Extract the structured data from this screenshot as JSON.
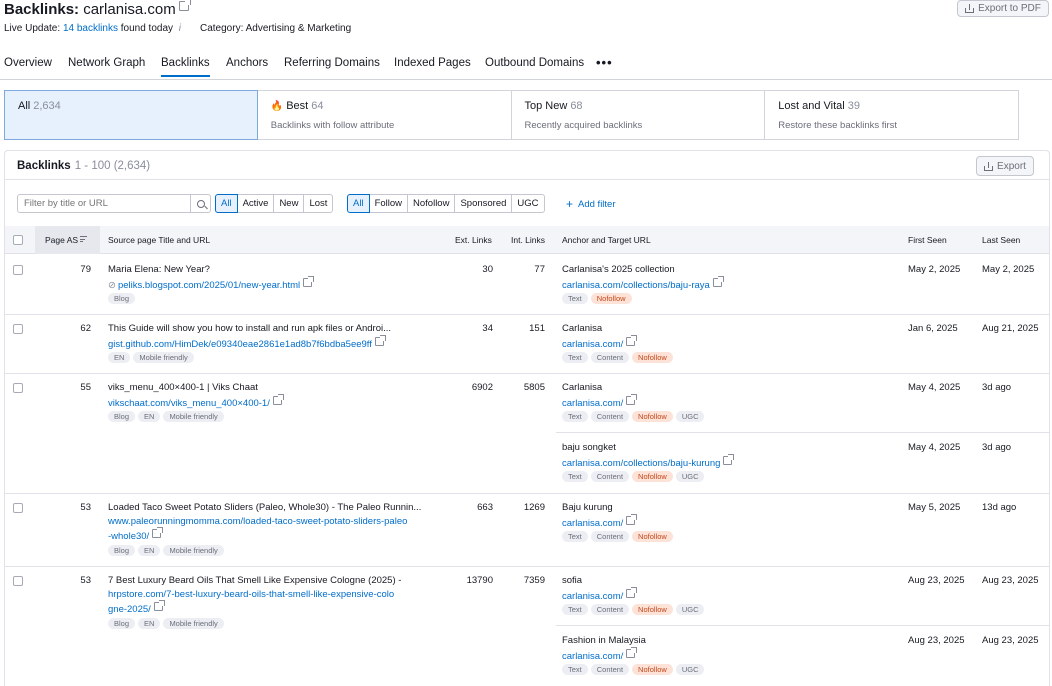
{
  "header": {
    "title_prefix": "Backlinks:",
    "domain": "carlanisa.com",
    "live_update_label": "Live Update:",
    "live_update_link": "14 backlinks",
    "live_update_suffix": "found today",
    "info_icon": "i",
    "category": "Category: Advertising & Marketing",
    "export_pdf": "Export to PDF"
  },
  "tabs": [
    {
      "label": "Overview"
    },
    {
      "label": "Network Graph"
    },
    {
      "label": "Backlinks"
    },
    {
      "label": "Anchors"
    },
    {
      "label": "Referring Domains"
    },
    {
      "label": "Indexed Pages"
    },
    {
      "label": "Outbound Domains"
    }
  ],
  "tab_more": "•••",
  "cards": [
    {
      "title": "All",
      "count": "2,634",
      "subtitle": ""
    },
    {
      "title": "Best",
      "count": "64",
      "subtitle": "Backlinks with follow attribute"
    },
    {
      "title": "Top New",
      "count": "68",
      "subtitle": "Recently acquired backlinks"
    },
    {
      "title": "Lost and Vital",
      "count": "39",
      "subtitle": "Restore these backlinks first"
    }
  ],
  "panel": {
    "title": "Backlinks",
    "range": "1 - 100 (2,634)",
    "export": "Export"
  },
  "filters": {
    "search_placeholder": "Filter by title or URL",
    "status": [
      "All",
      "Active",
      "New",
      "Lost"
    ],
    "type": [
      "All",
      "Follow",
      "Nofollow",
      "Sponsored",
      "UGC"
    ],
    "add_filter": "Add filter"
  },
  "columns": {
    "page_as": "Page AS",
    "source": "Source page Title and URL",
    "ext_links": "Ext. Links",
    "int_links": "Int. Links",
    "anchor": "Anchor and Target URL",
    "first_seen": "First Seen",
    "last_seen": "Last Seen"
  },
  "rows": [
    {
      "as": "79",
      "title": "Maria Elena: New Year?",
      "url1": "peliks.blogspot.com/2025/01/new-year.html",
      "url2": "",
      "src_tags": [
        "Blog"
      ],
      "ext": "30",
      "int": "77",
      "anchors": [
        {
          "anchor": "Carlanisa's 2025 collection",
          "target": "carlanisa.com/collections/baju-raya",
          "tags": [
            "Text",
            "Nofollow"
          ],
          "first": "May 2, 2025",
          "last": "May 2, 2025"
        }
      ]
    },
    {
      "as": "62",
      "title": "This Guide will show you how to install and run apk files or Androi...",
      "url1": "gist.github.com/HimDek/e09340eae2861e1ad8b7f6bdba5ee9ff",
      "url2": "",
      "src_tags": [
        "EN",
        "Mobile friendly"
      ],
      "ext": "34",
      "int": "151",
      "anchors": [
        {
          "anchor": "Carlanisa",
          "target": "carlanisa.com/",
          "tags": [
            "Text",
            "Content",
            "Nofollow"
          ],
          "first": "Jan 6, 2025",
          "last": "Aug 21, 2025"
        }
      ]
    },
    {
      "as": "55",
      "title": "viks_menu_400×400-1 | Viks Chaat",
      "url1": "vikschaat.com/viks_menu_400×400-1/",
      "url2": "",
      "src_tags": [
        "Blog",
        "EN",
        "Mobile friendly"
      ],
      "ext": "6902",
      "int": "5805",
      "anchors": [
        {
          "anchor": "Carlanisa",
          "target": "carlanisa.com/",
          "tags": [
            "Text",
            "Content",
            "Nofollow",
            "UGC"
          ],
          "first": "May 4, 2025",
          "last": "3d ago"
        },
        {
          "anchor": "baju songket",
          "target": "carlanisa.com/collections/baju-kurung",
          "tags": [
            "Text",
            "Content",
            "Nofollow",
            "UGC"
          ],
          "first": "May 4, 2025",
          "last": "3d ago"
        }
      ]
    },
    {
      "as": "53",
      "title": "Loaded Taco Sweet Potato Sliders (Paleo, Whole30) - The Paleo Runnin...",
      "url1": "www.paleorunningmomma.com/loaded-taco-sweet-potato-sliders-paleo",
      "url2": "-whole30/",
      "src_tags": [
        "Blog",
        "EN",
        "Mobile friendly"
      ],
      "ext": "663",
      "int": "1269",
      "anchors": [
        {
          "anchor": "Baju kurung",
          "target": "carlanisa.com/",
          "tags": [
            "Text",
            "Content",
            "Nofollow"
          ],
          "first": "May 5, 2025",
          "last": "13d ago"
        }
      ]
    },
    {
      "as": "53",
      "title": "7 Best Luxury Beard Oils That Smell Like Expensive Cologne (2025) -",
      "url1": "hrpstore.com/7-best-luxury-beard-oils-that-smell-like-expensive-colo",
      "url2": "gne-2025/",
      "src_tags": [
        "Blog",
        "EN",
        "Mobile friendly"
      ],
      "ext": "13790",
      "int": "7359",
      "anchors": [
        {
          "anchor": "sofia",
          "target": "carlanisa.com/",
          "tags": [
            "Text",
            "Content",
            "Nofollow",
            "UGC"
          ],
          "first": "Aug 23, 2025",
          "last": "Aug 23, 2025"
        },
        {
          "anchor": "Fashion in Malaysia",
          "target": "carlanisa.com/",
          "tags": [
            "Text",
            "Content",
            "Nofollow",
            "UGC"
          ],
          "first": "Aug 23, 2025",
          "last": "Aug 23, 2025"
        }
      ]
    }
  ],
  "colors": {
    "accent": "#006dca",
    "nofollow_bg": "#fde2d8",
    "nofollow_text": "#c4481a",
    "active_card_bg": "#e6f1fd"
  }
}
